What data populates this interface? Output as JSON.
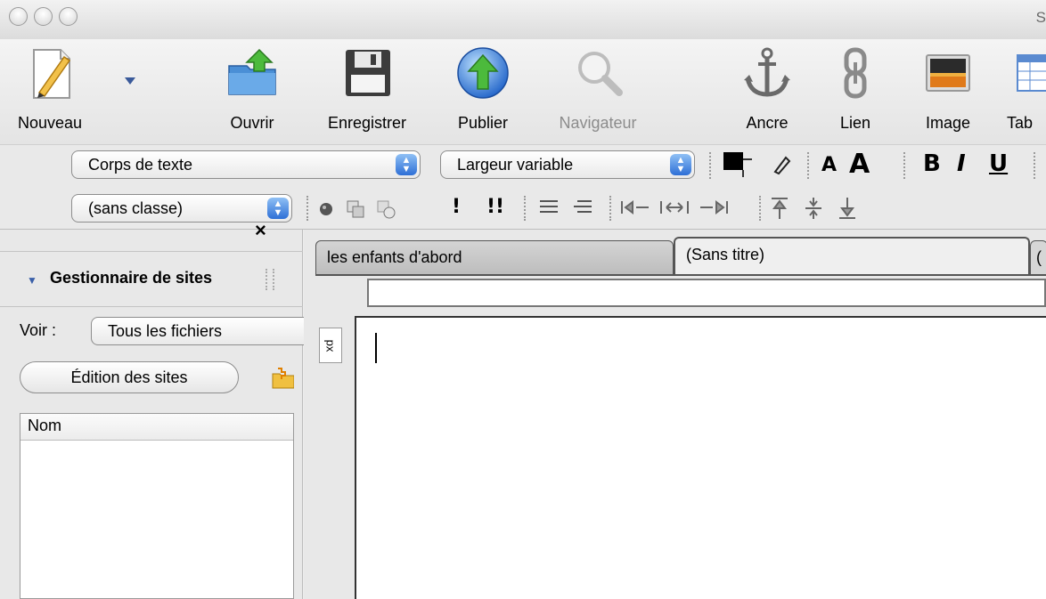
{
  "window": {
    "title_partial": "S"
  },
  "toolbar": {
    "new_label": "Nouveau",
    "open_label": "Ouvrir",
    "save_label": "Enregistrer",
    "publish_label": "Publier",
    "browse_label": "Navigateur",
    "anchor_label": "Ancre",
    "link_label": "Lien",
    "image_label": "Image",
    "table_label_partial": "Tab"
  },
  "format_toolbar": {
    "paragraph_style": "Corps de texte",
    "font_family": "Largeur variable",
    "class_select": "(sans classe)",
    "decrease_font_glyph": "A",
    "increase_font_glyph": "A",
    "bold_glyph": "B",
    "italic_glyph": "I",
    "underline_glyph": "U",
    "exclaim_single": "!",
    "exclaim_double": "!!"
  },
  "sidebar": {
    "close_glyph": "×",
    "section_title": "Gestionnaire de sites",
    "view_label": "Voir :",
    "view_value": "Tous les fichiers",
    "edit_sites_label": "Édition des sites",
    "column_name": "Nom"
  },
  "editor": {
    "tabs": [
      {
        "label": "les enfants d'abord"
      },
      {
        "label": "(Sans titre)"
      },
      {
        "label": "("
      }
    ],
    "ruler_unit": "px"
  },
  "colors": {
    "accent_blue": "#2e6fd6",
    "text_color_swatch": "#000000"
  }
}
